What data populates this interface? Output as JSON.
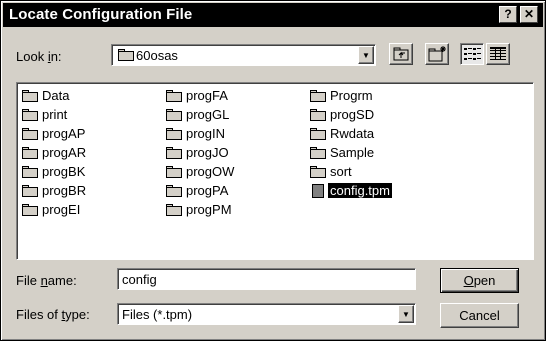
{
  "dialog": {
    "title": "Locate Configuration File",
    "help_button": "?",
    "close_button": "✕"
  },
  "look_in": {
    "label_pre": "Look ",
    "label_key": "i",
    "label_post": "n:",
    "value": "60osas"
  },
  "files": {
    "column1": [
      "Data",
      "print",
      "progAP",
      "progAR",
      "progBK",
      "progBR",
      "progEI"
    ],
    "column2": [
      "progFA",
      "progGL",
      "progIN",
      "progJO",
      "progOW",
      "progPA",
      "progPM"
    ],
    "column3": [
      "Progrm",
      "progSD",
      "Rwdata",
      "Sample",
      "sort"
    ],
    "selected_file": "config.tpm"
  },
  "file_name": {
    "label_pre": "File ",
    "label_key": "n",
    "label_post": "ame:",
    "value": "config"
  },
  "file_type": {
    "label_pre": "Files of ",
    "label_key": "t",
    "label_post": "ype:",
    "value": "Files (*.tpm)"
  },
  "buttons": {
    "open_key": "O",
    "open_rest": "pen",
    "cancel": "Cancel"
  }
}
